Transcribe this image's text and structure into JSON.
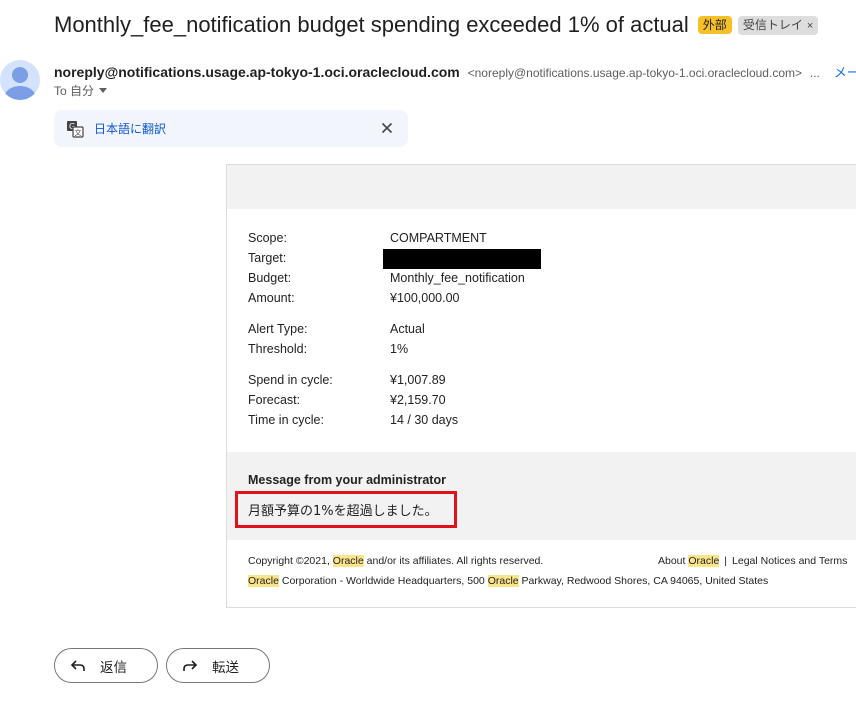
{
  "email": {
    "subject": "Monthly_fee_notification budget spending exceeded 1% of actual",
    "badge_external": "外部",
    "badge_inbox": "受信トレイ",
    "badge_inbox_close": "×",
    "sender_name": "noreply@notifications.usage.ap-tokyo-1.oci.oraclecloud.com",
    "sender_address": "<noreply@notifications.usage.ap-tokyo-1.oci.oraclecloud.com>",
    "sender_more": "...",
    "sender_extra": "メー",
    "to_label": "To 自分",
    "translate_label": "日本語に翻訳"
  },
  "body": {
    "fields": [
      {
        "label": "Scope:",
        "value": "COMPARTMENT"
      },
      {
        "label": "Target:",
        "value": ""
      },
      {
        "label": "Budget:",
        "value": "Monthly_fee_notification"
      },
      {
        "label": "Amount:",
        "value": "¥100,000.00"
      },
      {
        "label": "Alert Type:",
        "value": "Actual"
      },
      {
        "label": "Threshold:",
        "value": "1%"
      },
      {
        "label": "Spend in cycle:",
        "value": "¥1,007.89"
      },
      {
        "label": "Forecast:",
        "value": "¥2,159.70"
      },
      {
        "label": "Time in cycle:",
        "value": "14 / 30 days"
      }
    ],
    "admin_title": "Message from your administrator",
    "admin_message": "月額予算の1%を超過しました。"
  },
  "footer": {
    "copyright_prefix": "Copyright ©2021, ",
    "oracle": "Oracle",
    "copyright_suffix": " and/or its affiliates. All rights reserved.",
    "about_prefix": "About ",
    "separator": "|",
    "legal": "Legal Notices and Terms",
    "address_mid": " Corporation - Worldwide Headquarters, 500 ",
    "address_suffix": " Parkway, Redwood Shores, CA 94065, United States"
  },
  "actions": {
    "reply": "返信",
    "forward": "転送"
  },
  "colors": {
    "external_badge": "#f6c026",
    "highlight_box": "#e0111a",
    "keyword_highlight": "#fbe58b"
  }
}
